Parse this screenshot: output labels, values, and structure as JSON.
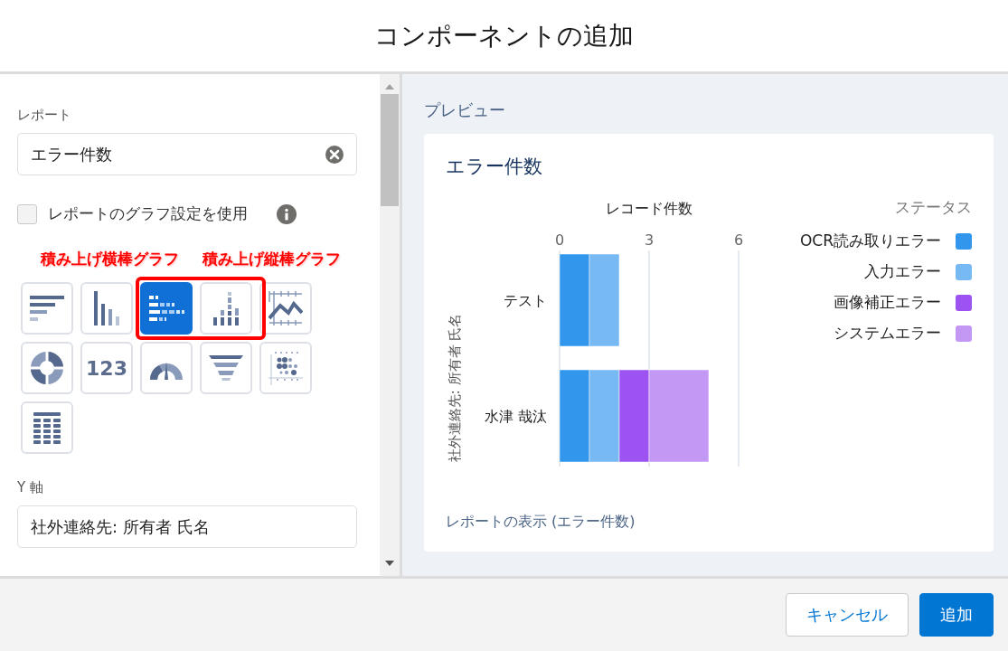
{
  "dialog": {
    "title": "コンポーネントの追加"
  },
  "settings": {
    "report_label": "レポート",
    "report_value": "エラー件数",
    "use_report_chart": {
      "label": "レポートのグラフ設定を使用",
      "checked": false
    },
    "annotations": [
      "積み上げ横棒グラフ",
      "積み上げ縦棒グラフ"
    ],
    "chart_types": [
      {
        "kind": "bar",
        "selected": false
      },
      {
        "kind": "column",
        "selected": false
      },
      {
        "kind": "stacked-bar",
        "selected": true
      },
      {
        "kind": "stacked-column",
        "selected": false
      },
      {
        "kind": "line",
        "selected": false
      },
      {
        "kind": "donut",
        "selected": false
      },
      {
        "kind": "metric",
        "selected": false,
        "label": "123"
      },
      {
        "kind": "gauge",
        "selected": false
      },
      {
        "kind": "funnel",
        "selected": false
      },
      {
        "kind": "scatter",
        "selected": false
      },
      {
        "kind": "table",
        "selected": false
      }
    ],
    "y_axis_label": "Y 軸",
    "y_axis_value": "社外連絡先: 所有者 氏名"
  },
  "preview": {
    "heading": "プレビュー",
    "card_title": "エラー件数",
    "legend_title": "ステータス",
    "link": "レポートの表示 (エラー件数)",
    "chart_data": {
      "type": "bar",
      "orientation": "horizontal",
      "stacked": true,
      "xlabel": "レコード件数",
      "ylabel": "社外連絡先: 所有者 氏名",
      "categories": [
        "テスト",
        "水津 哉汰"
      ],
      "xlim": [
        0,
        6
      ],
      "xticks": [
        0,
        3,
        6
      ],
      "series": [
        {
          "name": "OCR読み取りエラー",
          "color": "#3296ed",
          "values": [
            1,
            1
          ]
        },
        {
          "name": "入力エラー",
          "color": "#77b9f2",
          "values": [
            1,
            1
          ]
        },
        {
          "name": "画像補正エラー",
          "color": "#9d53f2",
          "values": [
            0,
            1
          ]
        },
        {
          "name": "システムエラー",
          "color": "#c398f5",
          "values": [
            0,
            2
          ]
        }
      ]
    }
  },
  "footer": {
    "buttons": [
      {
        "label": "キャンセル",
        "kind": "secondary"
      },
      {
        "label": "追加",
        "kind": "primary"
      }
    ]
  }
}
